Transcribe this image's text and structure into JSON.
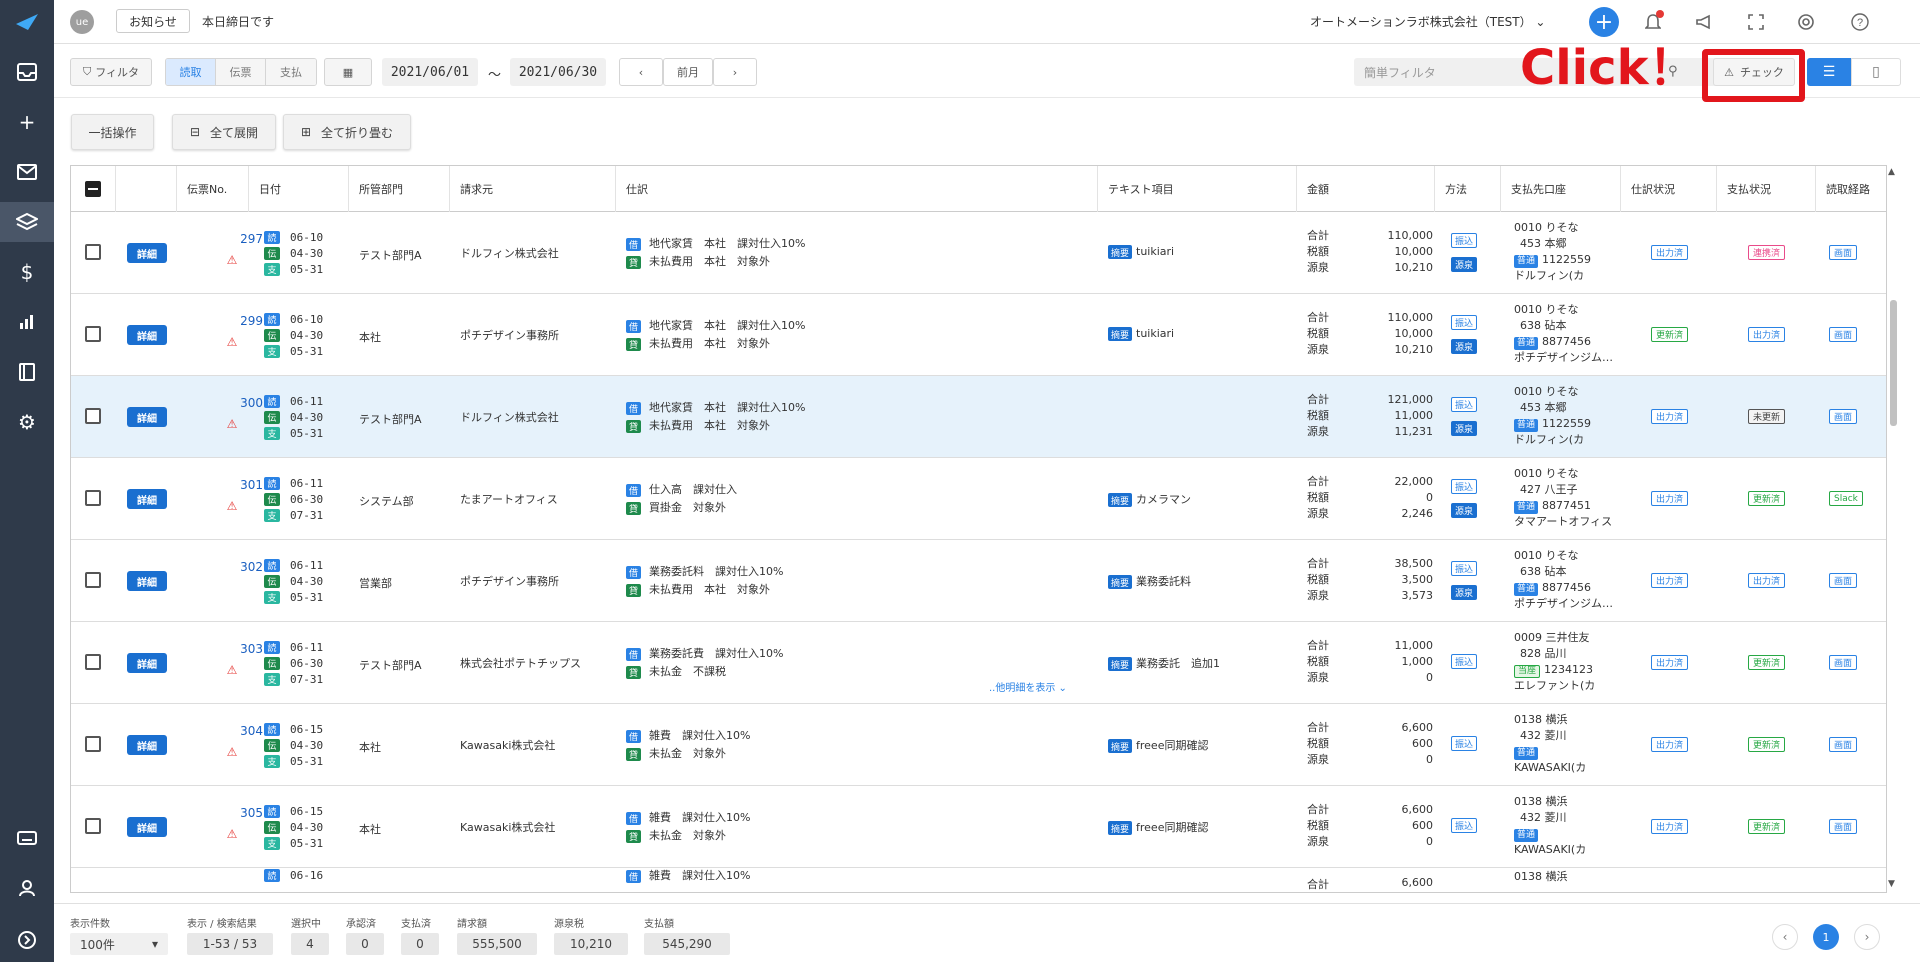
{
  "app": {
    "avatar": "ue",
    "news_label": "お知らせ",
    "message": "本日締日です",
    "company": "オートメーションラボ株式会社（TEST） ⌄"
  },
  "toolbar": {
    "filter": "フィルタ",
    "seg": [
      "読取",
      "伝票",
      "支払"
    ],
    "date_from": "2021/06/01",
    "tilde": "〜",
    "date_to": "2021/06/30",
    "prev_label": "前月",
    "quick_filter_placeholder": "簡単フィルタ",
    "check_label": "チェック",
    "annotation": "Click！"
  },
  "actions": {
    "bulk": "一括操作",
    "expand_all": "全て展開",
    "collapse_all": "全て折り畳む"
  },
  "columns": [
    "",
    "",
    "伝票No.",
    "日付",
    "所管部門",
    "請求元",
    "仕訳",
    "テキスト項目",
    "金額",
    "方法",
    "支払先口座",
    "仕訳状況",
    "支払状況",
    "読取経路"
  ],
  "row_labels": {
    "detail": "詳細",
    "total": "合計",
    "tax": "税額",
    "withholding": "源泉",
    "tekiyo": "摘要",
    "show_more": "..他明細を表示 ⌄"
  },
  "rows": [
    {
      "no": "297",
      "warn": true,
      "dates": [
        "06-10",
        "04-30",
        "05-31"
      ],
      "dept": "テスト部門A",
      "vendor": "ドルフィン株式会社",
      "j1": "地代家賃　本社　課対仕入10%",
      "j2": "未払費用　本社　対象外",
      "text": "tuikiari",
      "total": "110,000",
      "tax": "10,000",
      "wh": "10,210",
      "methods": [
        "振込",
        "源泉"
      ],
      "acct1": "0010 りそな",
      "acct2": "453 本郷",
      "acct_type": "普通",
      "acct_no": "1122559",
      "acct_name": "ドルフィン(カ",
      "shiwake": "出力済",
      "shiharai": "連携済",
      "route": "画面",
      "shiharai_style": "pink"
    },
    {
      "no": "299",
      "warn": true,
      "dates": [
        "06-10",
        "04-30",
        "05-31"
      ],
      "dept": "本社",
      "vendor": "ポチデザイン事務所",
      "j1": "地代家賃　本社　課対仕入10%",
      "j2": "未払費用　本社　対象外",
      "text": "tuikiari",
      "total": "110,000",
      "tax": "10,000",
      "wh": "10,210",
      "methods": [
        "振込",
        "源泉"
      ],
      "acct1": "0010 りそな",
      "acct2": "638 砧本",
      "acct_type": "普通",
      "acct_no": "8877456",
      "acct_name": "ポチデザインジム…",
      "shiwake": "更新済",
      "shiharai": "出力済",
      "route": "画面",
      "shiwake_style": "green",
      "shiharai_style": "blue"
    },
    {
      "no": "300",
      "warn": true,
      "dates": [
        "06-11",
        "04-30",
        "05-31"
      ],
      "dept": "テスト部門A",
      "vendor": "ドルフィン株式会社",
      "j1": "地代家賃　本社　課対仕入10%",
      "j2": "未払費用　本社　対象外",
      "text": "",
      "total": "121,000",
      "tax": "11,000",
      "wh": "11,231",
      "methods": [
        "振込",
        "源泉"
      ],
      "acct1": "0010 りそな",
      "acct2": "453 本郷",
      "acct_type": "普通",
      "acct_no": "1122559",
      "acct_name": "ドルフィン(カ",
      "shiwake": "出力済",
      "shiharai": "未更新",
      "route": "画面",
      "shiharai_style": "gray",
      "highlight": true
    },
    {
      "no": "301",
      "warn": true,
      "dates": [
        "06-11",
        "06-30",
        "07-31"
      ],
      "dept": "システム部",
      "vendor": "たまアートオフィス",
      "j1": "仕入高　課対仕入",
      "j2": "買掛金　対象外",
      "text": "カメラマン",
      "total": "22,000",
      "tax": "0",
      "wh": "2,246",
      "methods": [
        "振込",
        "源泉"
      ],
      "acct1": "0010 りそな",
      "acct2": "427 八王子",
      "acct_type": "普通",
      "acct_no": "8877451",
      "acct_name": "タマアートオフィス",
      "shiwake": "出力済",
      "shiharai": "更新済",
      "route": "Slack",
      "shiharai_style": "green",
      "route_style": "green"
    },
    {
      "no": "302",
      "warn": false,
      "dates": [
        "06-11",
        "04-30",
        "05-31"
      ],
      "dept": "営業部",
      "vendor": "ポチデザイン事務所",
      "j1": "業務委託料　課対仕入10%",
      "j2": "未払費用　本社　対象外",
      "text": "業務委託料",
      "total": "38,500",
      "tax": "3,500",
      "wh": "3,573",
      "methods": [
        "振込",
        "源泉"
      ],
      "acct1": "0010 りそな",
      "acct2": "638 砧本",
      "acct_type": "普通",
      "acct_no": "8877456",
      "acct_name": "ポチデザインジム…",
      "shiwake": "出力済",
      "shiharai": "出力済",
      "route": "画面",
      "shiharai_style": "blue"
    },
    {
      "no": "303",
      "warn": true,
      "dates": [
        "06-11",
        "06-30",
        "07-31"
      ],
      "dept": "テスト部門A",
      "vendor": "株式会社ポテトチップス",
      "j1": "業務委託費　課対仕入10%",
      "j2": "未払金　不課税",
      "text": "業務委託　追加1",
      "total": "11,000",
      "tax": "1,000",
      "wh": "0",
      "methods": [
        "振込"
      ],
      "acct1": "0009 三井住友",
      "acct2": "828 品川",
      "acct_type": "当座",
      "acct_no": "1234123",
      "acct_name": "エレファント(カ",
      "shiwake": "出力済",
      "shiharai": "更新済",
      "route": "画面",
      "shiharai_style": "green",
      "more": true
    },
    {
      "no": "304",
      "warn": true,
      "dates": [
        "06-15",
        "04-30",
        "05-31"
      ],
      "dept": "本社",
      "vendor": "Kawasaki株式会社",
      "j1": "雑費　課対仕入10%",
      "j2": "未払金　対象外",
      "text": "freee同期確認",
      "total": "6,600",
      "tax": "600",
      "wh": "0",
      "methods": [
        "振込"
      ],
      "acct1": "0138 横浜",
      "acct2": "432 菱川",
      "acct_type": "普通",
      "acct_no": "",
      "acct_name": "KAWASAKI(カ",
      "shiwake": "出力済",
      "shiharai": "更新済",
      "route": "画面",
      "shiharai_style": "green"
    },
    {
      "no": "305",
      "warn": true,
      "dates": [
        "06-15",
        "04-30",
        "05-31"
      ],
      "dept": "本社",
      "vendor": "Kawasaki株式会社",
      "j1": "雑費　課対仕入10%",
      "j2": "未払金　対象外",
      "text": "freee同期確認",
      "total": "6,600",
      "tax": "600",
      "wh": "0",
      "methods": [
        "振込"
      ],
      "acct1": "0138 横浜",
      "acct2": "432 菱川",
      "acct_type": "普通",
      "acct_no": "",
      "acct_name": "KAWASAKI(カ",
      "shiwake": "出力済",
      "shiharai": "更新済",
      "route": "画面",
      "shiharai_style": "green"
    }
  ],
  "partial_row": {
    "date": "06-16",
    "j1": "雑費　課対仕入10%",
    "total": "6,600",
    "acct1": "0138 横浜"
  },
  "footer": {
    "per_page_label": "表示件数",
    "per_page": "100件",
    "result_label": "表示 / 検索結果",
    "result": "1-53 / 53",
    "selected_label": "選択中",
    "selected": "4",
    "approved_label": "承認済",
    "approved": "0",
    "paid_label": "支払済",
    "paid": "0",
    "invoice_label": "請求額",
    "invoice": "555,500",
    "wh_label": "源泉税",
    "wh": "10,210",
    "payment_label": "支払額",
    "payment": "545,290",
    "page": "1"
  },
  "colors": {
    "accent": "#2a82e4",
    "sidebar": "#2f3a4a",
    "annotation": "#e2161c"
  }
}
